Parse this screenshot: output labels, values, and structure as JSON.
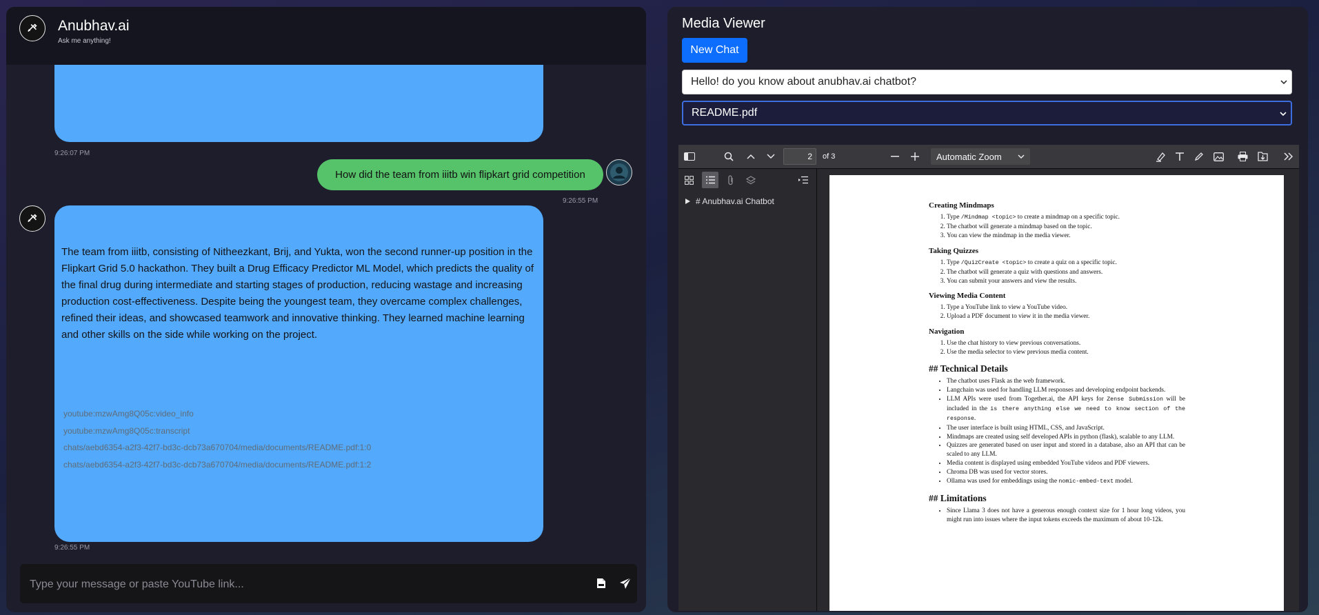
{
  "chat": {
    "title": "Anubhav.ai",
    "subtitle": "Ask me anything!",
    "messages": {
      "bot_first_timestamp": "9:26:07 PM",
      "user_text": "How did the team from iiitb win flipkart grid competition",
      "user_timestamp": "9:26:55 PM",
      "bot_answer": "The team from iiitb, consisting of Nitheezkant, Brij, and Yukta, won the second runner-up position in the Flipkart Grid 5.0 hackathon. They built a Drug Efficacy Predictor ML Model, which predicts the quality of the final drug during intermediate and starting stages of production, reducing wastage and increasing production cost-effectiveness. Despite being the youngest team, they overcame complex challenges, refined their ideas, and showcased teamwork and innovative thinking. They learned machine learning and other skills on the side while working on the project.",
      "references": [
        "youtube:mzwAmg8Q05c:video_info",
        "youtube:mzwAmg8Q05c:transcript",
        "chats/aebd6354-a2f3-42f7-bd3c-dcb73a670704/media/documents/README.pdf:1:0",
        "chats/aebd6354-a2f3-42f7-bd3c-dcb73a670704/media/documents/README.pdf:1:2"
      ],
      "bot_answer_timestamp": "9:26:55 PM"
    },
    "input_placeholder": "Type your message or paste YouTube link..."
  },
  "media": {
    "title": "Media Viewer",
    "new_chat_label": "New Chat",
    "chat_select_value": "Hello! do you know about anubhav.ai chatbot?",
    "media_select_value": "README.pdf"
  },
  "pdf": {
    "page_number": "2",
    "page_of": "of 3",
    "zoom": "Automatic Zoom",
    "outline_item": "# Anubhav.ai Chatbot",
    "content": {
      "mindmaps_heading": "Creating Mindmaps",
      "mindmaps_1_pre": "Type ",
      "mindmaps_1_code": "/Mindmap <topic>",
      "mindmaps_1_post": " to create a mindmap on a specific topic.",
      "mindmaps_2": "The chatbot will generate a mindmap based on the topic.",
      "mindmaps_3": "You can view the mindmap in the media viewer.",
      "quizzes_heading": "Taking Quizzes",
      "quizzes_1_pre": "Type ",
      "quizzes_1_code": "/QuizCreate <topic>",
      "quizzes_1_post": " to create a quiz on a specific topic.",
      "quizzes_2": "The chatbot will generate a quiz with questions and answers.",
      "quizzes_3": "You can submit your answers and view the results.",
      "media_heading": "Viewing Media Content",
      "media_1": "Type a YouTube link to view a YouTube video.",
      "media_2": "Upload a PDF document to view it in the media viewer.",
      "nav_heading": "Navigation",
      "nav_1": "Use the chat history to view previous conversations.",
      "nav_2": "Use the media selector to view previous media content.",
      "tech_heading": "## Technical Details",
      "tech_1": "The chatbot uses Flask as the web framework.",
      "tech_2": "Langchain was used for handling LLM responses and developing endpoint backends.",
      "tech_3_pre": "LLM APIs were used from Together.ai, the API keys for ",
      "tech_3_code1": "Zense Submission",
      "tech_3_mid": " will be included in the ",
      "tech_3_code2": "is there anything else we need to know section of the response",
      "tech_3_post": ".",
      "tech_4": "The user interface is built using HTML, CSS, and JavaScript.",
      "tech_5": "Mindmaps are created using self developed APIs in python (flask), scalable to any LLM.",
      "tech_6": "Quizzes are generated based on user input and stored in a database, also an API that can be scaled to any LLM.",
      "tech_7": "Media content is displayed using embedded YouTube videos and PDF viewers.",
      "tech_8": "Chroma DB was used for vector stores.",
      "tech_9_pre": "Ollama was used for embeddings using the ",
      "tech_9_code": "nomic-embed-text",
      "tech_9_post": " model.",
      "limits_heading": "## Limitations",
      "limits_1": "Since Llama 3 does not have a generous enough context size for 1 hour long videos, you might run into issues where the input tokens exceeds the maximum of about 10-12k."
    }
  },
  "colors": {
    "bot_bubble": "#53a9fb",
    "user_bubble": "#56c26a",
    "new_chat_button": "#0d6efd",
    "panel_bg": "#1d1d2b"
  },
  "icons": [
    "bot-avatar-icon",
    "user-avatar-icon",
    "pdf-upload-icon",
    "send-icon",
    "sidebar-toggle-icon",
    "search-icon",
    "chevron-up-icon",
    "chevron-down-icon",
    "minus-icon",
    "plus-icon",
    "highlight-icon",
    "text-icon",
    "draw-icon",
    "image-icon",
    "print-icon",
    "save-icon",
    "tools-icon",
    "thumbnails-icon",
    "outline-icon",
    "attachments-icon",
    "layers-icon",
    "current-outline-icon"
  ]
}
